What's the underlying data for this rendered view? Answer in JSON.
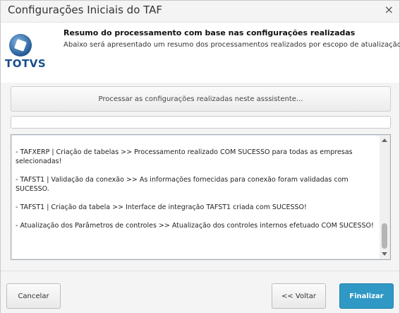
{
  "window": {
    "title": "Configurações Iniciais do TAF",
    "close_glyph": "×"
  },
  "header": {
    "logo_text": "TOTVS",
    "title": "Resumo do processamento com base nas configurações realizadas",
    "subtitle": "Abaixo será apresentado um resumo dos processamentos realizados por escopo de atualização..."
  },
  "main": {
    "process_button_label": "Processar as configurações realizadas neste asssistente...",
    "progress": 0,
    "log_lines": [
      "- TAFXERP | Criação de tabelas  >>  Processamento realizado COM SUCESSO para todas as empresas selecionadas!",
      "- TAFST1 | Validação da conexão  >>  As informações fornecidas para conexão foram validadas com SUCESSO.",
      "- TAFST1 | Criação da tabela  >>  Interface de integração TAFST1 criada com SUCESSO!",
      "- Atualização dos Parâmetros de controles  >>  Atualização dos controles internos efetuado COM SUCESSO!"
    ]
  },
  "footer": {
    "cancel_label": "Cancelar",
    "back_label": "<< Voltar",
    "finish_label": "Finalizar"
  },
  "colors": {
    "accent": "#2f98c4",
    "logo": "#1a4e8c"
  },
  "icons": {
    "close": "close-icon",
    "logo": "totvs-logo-icon"
  }
}
